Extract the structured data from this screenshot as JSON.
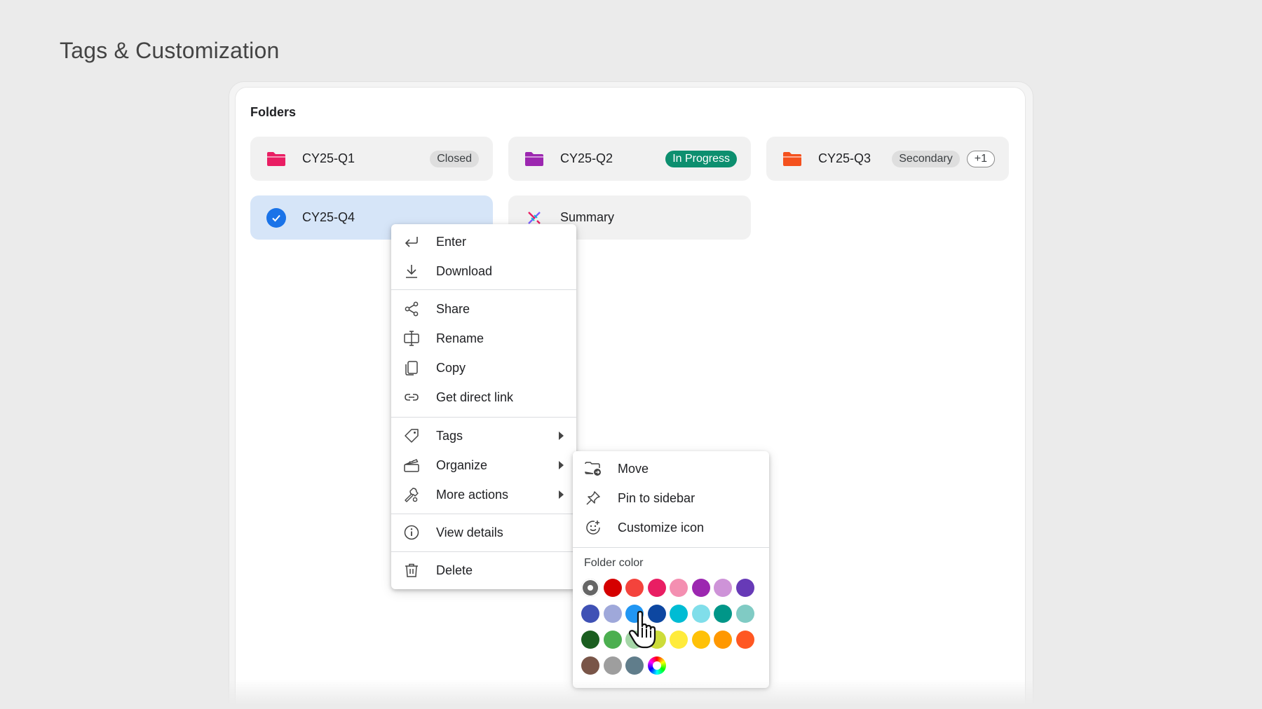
{
  "page": {
    "title": "Tags & Customization"
  },
  "section": {
    "title": "Folders"
  },
  "folders": [
    {
      "name": "CY25-Q1",
      "icon": "folder-icon",
      "color": "#e91e63",
      "badges": [
        "Closed"
      ]
    },
    {
      "name": "CY25-Q2",
      "icon": "folder-icon",
      "color": "#9c27b0",
      "badges": [
        "In Progress"
      ]
    },
    {
      "name": "CY25-Q3",
      "icon": "folder-icon",
      "color": "#f4511e",
      "badges": [
        "Secondary",
        "+1"
      ]
    },
    {
      "name": "CY25-Q4",
      "icon": "check-circle-icon",
      "color": "#1a73e8",
      "badges": [],
      "selected": true
    },
    {
      "name": "Summary",
      "icon": "dna-icon",
      "color": "#7b61ff",
      "badges": []
    }
  ],
  "context_menu": {
    "items": [
      {
        "label": "Enter",
        "icon": "enter-icon"
      },
      {
        "label": "Download",
        "icon": "download-icon"
      },
      {
        "label": "Share",
        "icon": "share-icon"
      },
      {
        "label": "Rename",
        "icon": "rename-icon"
      },
      {
        "label": "Copy",
        "icon": "copy-icon"
      },
      {
        "label": "Get direct link",
        "icon": "link-icon"
      },
      {
        "label": "Tags",
        "icon": "tag-icon",
        "submenu": true
      },
      {
        "label": "Organize",
        "icon": "organize-icon",
        "submenu": true
      },
      {
        "label": "More actions",
        "icon": "tools-icon",
        "submenu": true
      },
      {
        "label": "View details",
        "icon": "info-icon"
      },
      {
        "label": "Delete",
        "icon": "trash-icon"
      }
    ]
  },
  "organize_menu": {
    "items": [
      {
        "label": "Move",
        "icon": "folder-move-icon"
      },
      {
        "label": "Pin to sidebar",
        "icon": "pin-icon"
      },
      {
        "label": "Customize icon",
        "icon": "emoji-icon"
      }
    ],
    "color_label": "Folder color",
    "colors": [
      [
        "#666666",
        "#d50000",
        "#f4433c",
        "#e91e63",
        "#f48fb1",
        "#9c27b0",
        "#ce93d8",
        "#673ab7"
      ],
      [
        "#3f51b5",
        "#9fa8da",
        "#2196f3",
        "#0d47a1",
        "#00bcd4",
        "#80deea",
        "#009688",
        "#80cbc4"
      ],
      [
        "#1b5e20",
        "#4caf50",
        "#a5d6a7",
        "#cddc39",
        "#ffeb3b",
        "#ffc107",
        "#ff9800",
        "#ff5722"
      ],
      [
        "#795548",
        "#9e9e9e",
        "#607d8b",
        "rainbow"
      ]
    ],
    "selected_color": "#666666"
  }
}
